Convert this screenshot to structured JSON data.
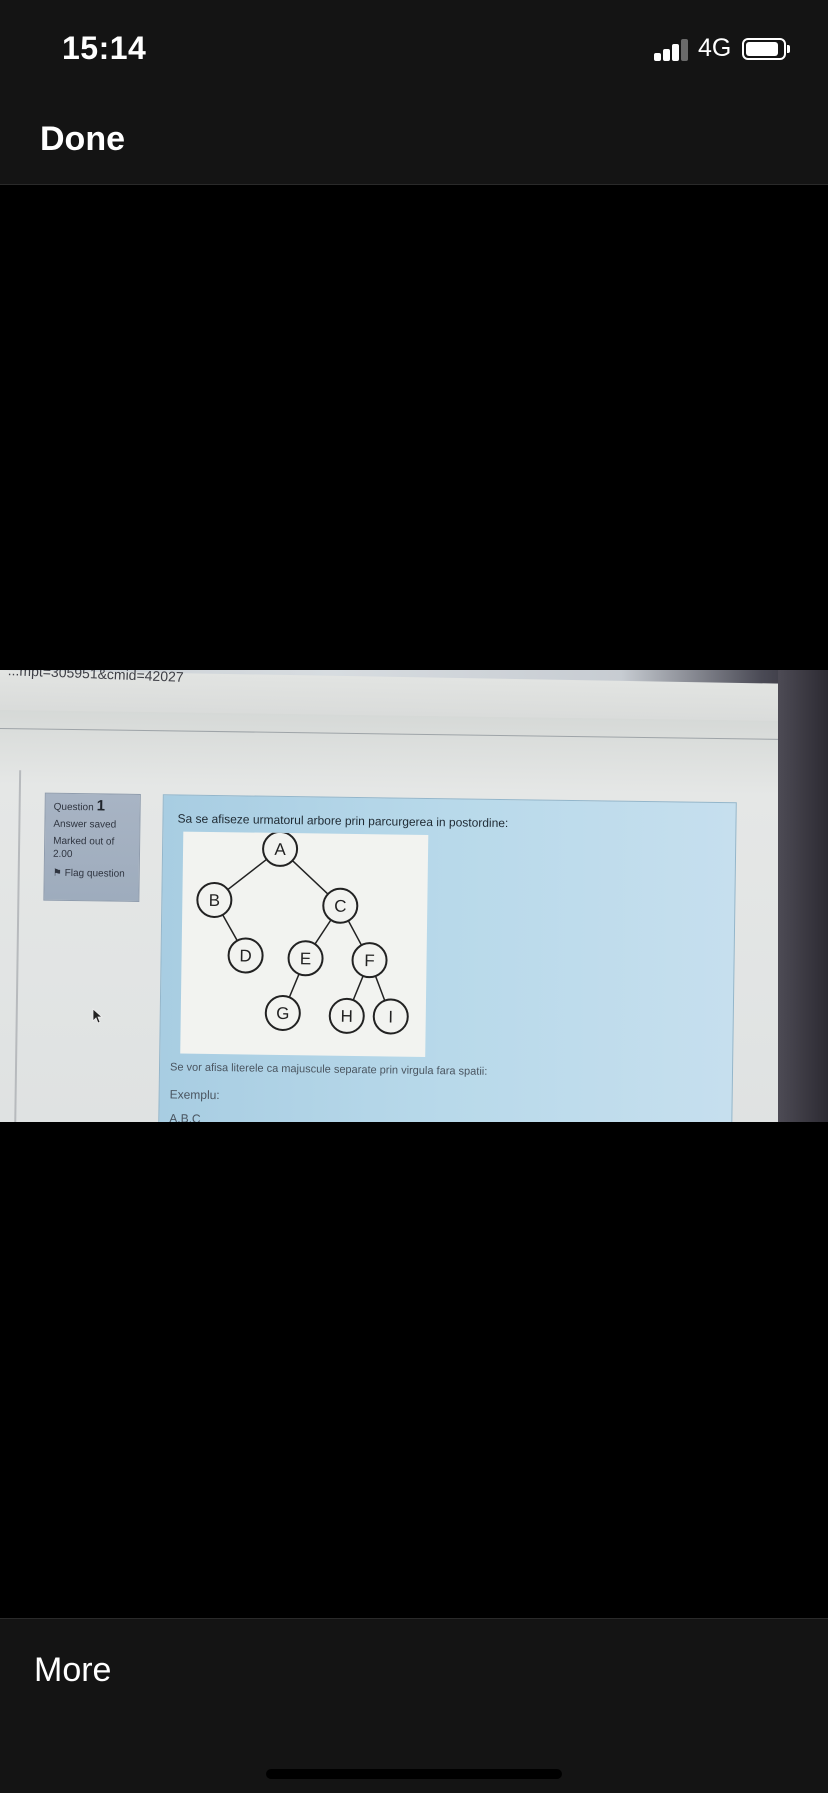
{
  "status_bar": {
    "time": "15:14",
    "network": "4G",
    "icons": [
      "signal-icon",
      "battery-icon"
    ]
  },
  "nav": {
    "done_label": "Done"
  },
  "photo": {
    "url_fragment": "...mpt=305951&cmid=42027",
    "question": {
      "label": "Question",
      "number": "1",
      "status": "Answer saved",
      "marked": "Marked out of",
      "marks": "2.00",
      "flag_label": "Flag question"
    },
    "prompt": "Sa se afiseze urmatorul arbore prin parcurgerea in postordine:",
    "tree_nodes": [
      "A",
      "B",
      "C",
      "D",
      "E",
      "F",
      "G",
      "H",
      "I"
    ],
    "instruction": "Se vor afisa literele ca majuscule separate prin virgula fara spatii:",
    "example_label": "Exemplu:",
    "example_value": "A,B,C"
  },
  "bottom": {
    "more_label": "More"
  }
}
